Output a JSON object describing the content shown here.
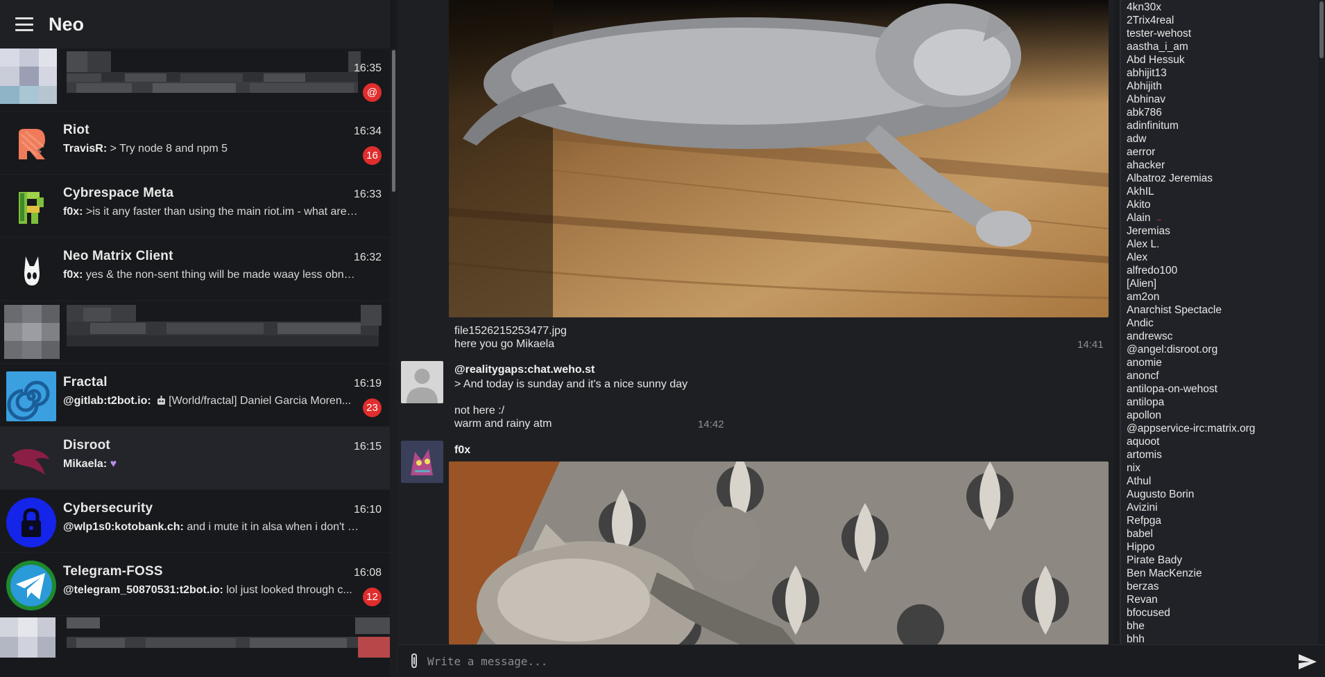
{
  "app": {
    "title": "Neo"
  },
  "rooms": [
    {
      "name": "",
      "time": "16:35",
      "preview_sender": "",
      "preview_text": "",
      "badge": "@",
      "blurred": true
    },
    {
      "name": "Riot",
      "time": "16:34",
      "preview_sender": "TravisR:",
      "preview_text": "> Try node 8 and npm 5",
      "badge": "16",
      "blurred": false
    },
    {
      "name": "Cybrespace Meta",
      "time": "16:33",
      "preview_sender": "f0x:",
      "preview_text": ">is it any faster than using the main riot.im - what are peo...",
      "badge": "",
      "blurred": false
    },
    {
      "name": "Neo Matrix Client",
      "time": "16:32",
      "preview_sender": "f0x:",
      "preview_text": "yes & the non-sent thing will be made waay less obnoxious",
      "badge": "",
      "blurred": false
    },
    {
      "name": "",
      "time": "",
      "preview_sender": "",
      "preview_text": "",
      "badge": "",
      "blurred": true
    },
    {
      "name": "Fractal",
      "time": "16:19",
      "preview_sender": "@gitlab:t2bot.io:",
      "preview_text": "[World/fractal] Daniel Garcia Moren...",
      "badge": "23",
      "blurred": false
    },
    {
      "name": "Disroot",
      "time": "16:15",
      "preview_sender": "Mikaela:",
      "preview_text": "",
      "badge": "",
      "blurred": false
    },
    {
      "name": "Cybersecurity",
      "time": "16:10",
      "preview_sender": "@wlp1s0:kotobank.ch:",
      "preview_text": "and i mute it in alsa when i don't nee...",
      "badge": "",
      "blurred": false
    },
    {
      "name": "Telegram-FOSS",
      "time": "16:08",
      "preview_sender": "@telegram_50870531:t2bot.io:",
      "preview_text": "lol just looked through c...",
      "badge": "12",
      "blurred": false
    }
  ],
  "chat": {
    "msg1": {
      "filename": "file1526215253477.jpg",
      "text": "here you go Mikaela",
      "time": "14:41"
    },
    "msg2": {
      "sender": "@realitygaps:chat.weho.st",
      "line1": "> And today is sunday and it's a nice sunny day",
      "line2": "not here :/",
      "line3": "warm and rainy atm",
      "time": "14:42"
    },
    "msg3": {
      "sender": "f0x"
    }
  },
  "members": [
    "4kn30x",
    "2Trix4real",
    "tester-wehost",
    "aastha_i_am",
    "Abd Hessuk",
    "abhijit13",
    "Abhijith",
    "Abhinav",
    "abk786",
    "adinfinitum",
    "adw",
    "aerror",
    "ahacker",
    "Albatroz Jeremias",
    "AkhIL",
    "Akito",
    "Alain",
    "Jeremias",
    "Alex L.",
    "Alex",
    "alfredo100",
    "[Alien]",
    "am2on",
    "Anarchist Spectacle",
    "Andic",
    "andrewsc",
    "@angel:disroot.org",
    "anomie",
    "anoncf",
    "antilopa-on-wehost",
    "antilopa",
    "apollon",
    "@appservice-irc:matrix.org",
    "aquoot",
    "artomis",
    "nix",
    "Athul",
    "Augusto Borin",
    "Avizini",
    "Refpga",
    "babel",
    "Hippo",
    "Pirate Bady",
    "Ben MacKenzie",
    "berzas",
    "Revan",
    "bfocused",
    "bhe",
    "bhh"
  ],
  "composer": {
    "placeholder": "Write a message..."
  },
  "colors": {
    "badge": "#e02d2d",
    "background": "#1e1f23",
    "sidebar": "#18191c",
    "members_bg": "#212227"
  }
}
